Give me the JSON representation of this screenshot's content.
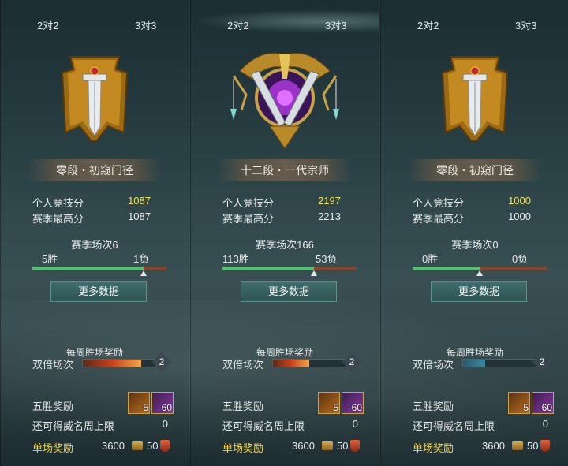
{
  "panels": [
    {
      "mode_a": "2对2",
      "mode_b": "3对3",
      "rank": "零段・初窥门径",
      "score_label": "个人竞技分",
      "score": "1087",
      "best_label": "赛季最高分",
      "best": "1087",
      "season": "赛季场次6",
      "wins": "5胜",
      "losses": "1负",
      "win_fraction": 0.83,
      "more_button": "更多数据",
      "weekly": "每周胜场奖励",
      "double_label": "双倍场次",
      "double_count": "2",
      "five_label": "五胜奖励",
      "item1_count": "5",
      "item2_count": "60",
      "cap_label": "还可得威名周上限",
      "cap_value": "0",
      "single_label": "单场奖励",
      "coins": "3600",
      "shield": "50"
    },
    {
      "mode_a": "2对2",
      "mode_b": "3对3",
      "rank": "十二段・一代宗师",
      "score_label": "个人竞技分",
      "score": "2197",
      "best_label": "赛季最高分",
      "best": "2213",
      "season": "赛季场次166",
      "wins": "113胜",
      "losses": "53负",
      "win_fraction": 0.68,
      "more_button": "更多数据",
      "weekly": "每周胜场奖励",
      "double_label": "双倍场次",
      "double_count": "2",
      "five_label": "五胜奖励",
      "item1_count": "5",
      "item2_count": "60",
      "cap_label": "还可得威名周上限",
      "cap_value": "0",
      "single_label": "单场奖励",
      "coins": "3600",
      "shield": "50"
    },
    {
      "mode_a": "2对2",
      "mode_b": "3对3",
      "rank": "零段・初窥门径",
      "score_label": "个人竞技分",
      "score": "1000",
      "best_label": "赛季最高分",
      "best": "1000",
      "season": "赛季场次0",
      "wins": "0胜",
      "losses": "0负",
      "win_fraction": 0.5,
      "more_button": "更多数据",
      "weekly": "每周胜场奖励",
      "double_label": "双倍场次",
      "double_count": "2",
      "five_label": "五胜奖励",
      "item1_count": "5",
      "item2_count": "60",
      "cap_label": "还可得威名周上限",
      "cap_value": "0",
      "single_label": "单场奖励",
      "coins": "3600",
      "shield": "50"
    }
  ],
  "colors": {
    "score": "#f2e24b",
    "win_bar": "#5fb87c",
    "loss_bar": "#7a4a34",
    "single_reward": "#f1d54a"
  },
  "icons": {
    "emblem_low": "banner-sword-icon",
    "emblem_high": "grandmaster-emblem-icon",
    "item1": "gold-chest-icon",
    "item2": "purple-gem-icon",
    "coin": "coin-icon",
    "shield": "shield-icon"
  }
}
